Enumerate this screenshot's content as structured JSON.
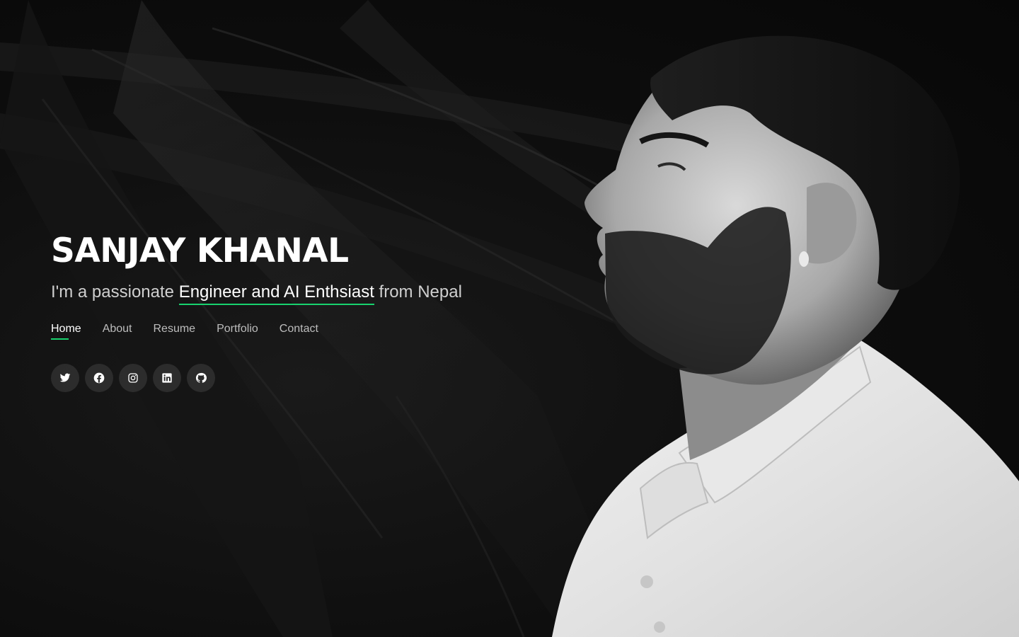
{
  "hero": {
    "name": "SANJAY KHANAL",
    "tagline_prefix": "I'm a passionate ",
    "tagline_highlight": "Engineer and AI Enthsiast",
    "tagline_suffix": " from Nepal"
  },
  "nav": {
    "items": [
      {
        "label": "Home",
        "active": true
      },
      {
        "label": "About",
        "active": false
      },
      {
        "label": "Resume",
        "active": false
      },
      {
        "label": "Portfolio",
        "active": false
      },
      {
        "label": "Contact",
        "active": false
      }
    ]
  },
  "social": {
    "icons": [
      "twitter-icon",
      "facebook-icon",
      "instagram-icon",
      "linkedin-icon",
      "github-icon"
    ]
  },
  "colors": {
    "accent": "#18d26e",
    "background": "#0b0b0b",
    "text": "#ffffff",
    "muted_text": "#bdbdbd"
  }
}
